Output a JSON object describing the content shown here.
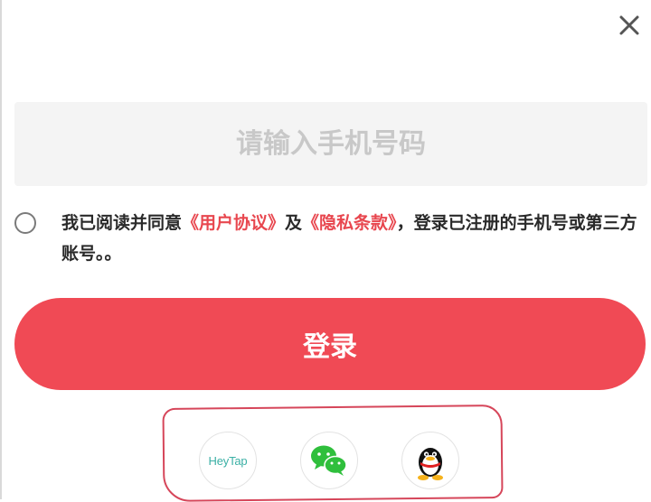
{
  "close": {
    "icon": "close-icon"
  },
  "phone": {
    "placeholder": "请输入手机号码",
    "value": ""
  },
  "agreement": {
    "prefix": "我已阅读并同意",
    "user_agreement": "《用户协议》",
    "and": "及",
    "privacy_policy": "《隐私条款》",
    "suffix": "，登录已注册的手机号或第三方账号。。"
  },
  "login": {
    "label": "登录"
  },
  "social": [
    {
      "name": "HeyTap",
      "label": "HeyTap",
      "icon": "heytap-icon"
    },
    {
      "name": "WeChat",
      "icon": "wechat-icon"
    },
    {
      "name": "QQ",
      "icon": "qq-icon"
    }
  ],
  "colors": {
    "accent": "#f04a55",
    "link": "#e8474f",
    "annotation": "#d6465a"
  }
}
